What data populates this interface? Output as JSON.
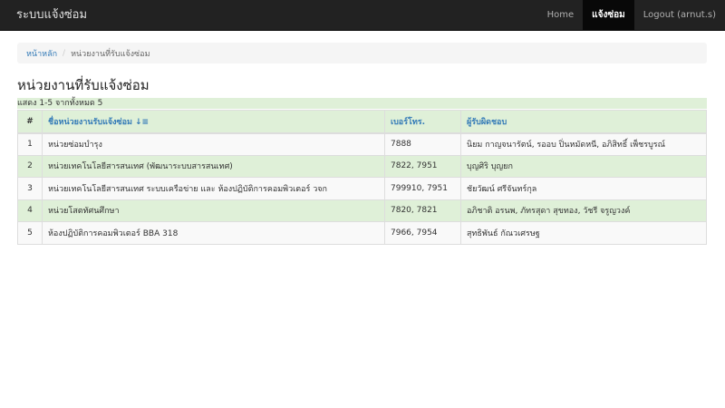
{
  "navbar": {
    "brand": "ระบบแจ้งซ่อม",
    "items": [
      {
        "label": "Home"
      },
      {
        "label": "แจ้งซ่อม"
      },
      {
        "label": "Logout (arnut.s)"
      }
    ]
  },
  "breadcrumb": {
    "home": "หน้าหลัก",
    "separator": "/",
    "current": "หน่วยงานที่รับแจ้งซ่อม"
  },
  "page_title": "หน่วยงานที่รับแจ้งซ่อม",
  "summary": "แสดง 1-5 จากทั้งหมด 5",
  "table": {
    "headers": {
      "num": "#",
      "name": "ชื่อหน่วยงานรับแจ้งซ่อม",
      "phone": "เบอร์โทร.",
      "responsible": "ผู้รับผิดชอบ"
    },
    "sort_icon": "sort-alpha-icon",
    "rows": [
      {
        "num": "1",
        "name": "หน่วยซ่อมบำรุง",
        "phone": "7888",
        "responsible": "นิยม กาญจนารัตน์, รออบ ปิ่นหมัดหนี, อภิสิทธิ์ เพ็ชรบูรณ์"
      },
      {
        "num": "2",
        "name": "หน่วยเทคโนโลยีสารสนเทศ (พัฒนาระบบสารสนเทศ)",
        "phone": "7822, 7951",
        "responsible": "บุญศิริ บุญยก"
      },
      {
        "num": "3",
        "name": "หน่วยเทคโนโลยีสารสนเทศ ระบบเครือข่าย และ ห้องปฏิบัติการคอมพิวเตอร์ วจก",
        "phone": "799910, 7951",
        "responsible": "ชัยวัฒน์ ศรีจันทร์กุล"
      },
      {
        "num": "4",
        "name": "หน่วยโสตทัศนศึกษา",
        "phone": "7820, 7821",
        "responsible": "อภิชาติ อรนพ, ภัทรสุดา สุขทอง, วัชรี จรูญวงค์"
      },
      {
        "num": "5",
        "name": "ห้องปฏิบัติการคอมพิวเตอร์ BBA 318",
        "phone": "7966, 7954",
        "responsible": "สุทธิพันธ์ กัณวเศรษฐ"
      }
    ]
  },
  "colors": {
    "navbar_bg": "#222222",
    "link": "#337ab7",
    "row_highlight": "#dff0d8"
  }
}
